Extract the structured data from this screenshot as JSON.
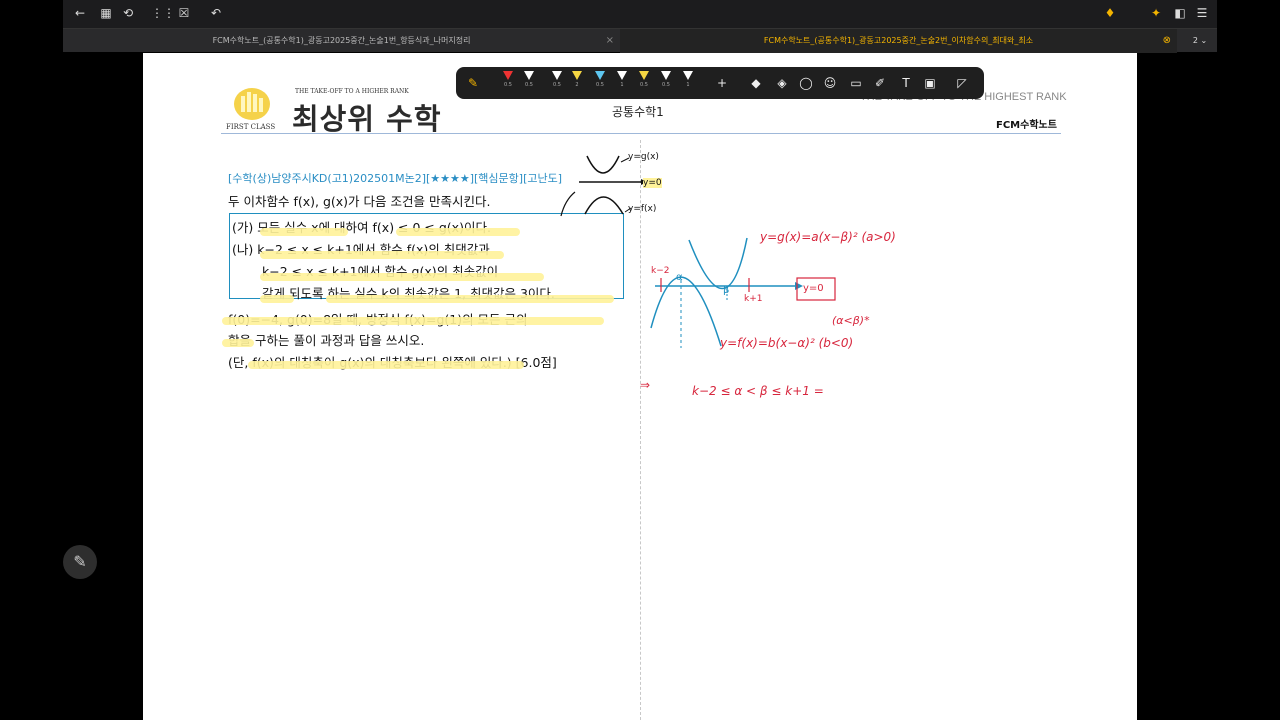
{
  "tabs": [
    {
      "label": "FCM수학노트_(공통수학1)_광동고2025중간_논술1번_항등식과_나머지정리",
      "active": false
    },
    {
      "label": "FCM수학노트_(공통수학1)_광동고2025중간_논술2번_이차함수의_최대와_최소",
      "active": true
    }
  ],
  "tab_count": "2",
  "header": {
    "brand_tagline": "THE TAKE-OFF TO A HIGHER RANK",
    "brand_title": "최상위 수학",
    "brand_sub": "FIRST CLASS",
    "subject": "공통수학1",
    "right_tagline": "THE TAKE-OFF TO THE HIGHEST RANK",
    "right_label": "FCM수학노트"
  },
  "pen_sizes": [
    "0.5",
    "0.5",
    "0.5",
    "2",
    "0.5",
    "1",
    "0.5",
    "0.5",
    "1"
  ],
  "problem": {
    "source": "[수학(상)남양주시KD(고1)202501M논2][★★★★][핵심문항][고난도]",
    "line1": "두 이차함수 f(x), g(x)가 다음 조건을 만족시킨다.",
    "cond_a": "(가) 모든 실수 x에 대하여 f(x) ≤ 0 ≤ g(x)이다.",
    "cond_b1": "(나) k−2 ≤ x ≤ k+1에서 함수 f(x)의 최댓값과",
    "cond_b2": "k−2 ≤ x ≤ k+1에서 함수 g(x)의 최솟값이",
    "cond_b3": "같게 되도록 하는 실수 k의 최솟값은 1, 최댓값은 3이다.",
    "line2": "f(0)=−4, g(0)=8일 때, 방정식 f(x)=g(1)의 모든 근의",
    "line3": "합을 구하는 풀이 과정과 답을 쓰시오.",
    "line4": "(단, f(x)의 대칭축이 g(x)의 대칭축보다 왼쪽에 있다.) [6.0점]"
  },
  "notes": {
    "top_g": "y=g(x)",
    "top_zero": "y=0",
    "top_f": "y=f(x)",
    "g_eq": "y=g(x)=a(x−β)²  (a>0)",
    "f_eq": "y=f(x)=b(x−α)²  (b<0)",
    "alpha_beta": "(α<β)*",
    "box_label": "y=0",
    "k2": "k−2",
    "k1": "k+1",
    "alpha": "α",
    "beta": "β",
    "arrow": "⇒",
    "ineq": "k−2 ≤ α < β ≤ k+1 ="
  },
  "colors": {
    "accent": "#f4b400",
    "ink_red": "#d7263d",
    "ink_blue": "#1f8fbf",
    "highlight": "#fff29a"
  }
}
